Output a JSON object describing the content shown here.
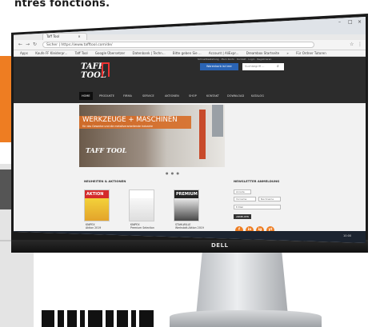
{
  "page": {
    "headline": "ntres fonctions."
  },
  "browser": {
    "tabs": [
      "Taff Tool",
      "×"
    ],
    "url": "Sicher | https://www.tafftool.com/de/",
    "bookmarks": [
      "Apps",
      "Kaufe FF Kleiderpr...",
      "Taff Tool",
      "Google Übersetzer",
      "Datenbank | Techn...",
      "Bitte geben Sie ...",
      "Account | AliExpr...",
      "Dreambox Startseite",
      "»",
      "Für Ordner Tutoren"
    ],
    "nav_icons": [
      "back-icon",
      "forward-icon",
      "reload-icon"
    ]
  },
  "site": {
    "logo": "TAFF TOOL",
    "top_links": [
      "Schnellbestellung",
      "Mein Konto",
      "Kontakt",
      "Login",
      "Registrieren"
    ],
    "header_button": "Warenkorb ist leer",
    "search_placeholder": "Suchbegriff ...",
    "nav": [
      "HOME",
      "PRODUKTE",
      "FIRMA",
      "SERVICE",
      "AKTIONEN",
      "SHOP",
      "KONTAKT",
      "DOWNLOAD",
      "KATALOG"
    ]
  },
  "hero": {
    "title": "WERKZEUGE + MASCHINEN",
    "subtitle": "für das Gewerbe und die metallverarbeitende Industrie",
    "logo": "TAFF TOOL",
    "dots": "● ● ●"
  },
  "promos": {
    "section_title": "NEUHEITEN & AKTIONEN",
    "items": [
      {
        "band": "AKTION",
        "caption_1": "KNIPEX",
        "caption_2": "Aktion 2019"
      },
      {
        "band": "",
        "caption_1": "KNIPEX",
        "caption_2": "Premium Selection"
      },
      {
        "band": "PREMIUM",
        "caption_1": "STAHLWILLE",
        "caption_2": "Werkstatt-Aktion 2019"
      }
    ]
  },
  "newsletter": {
    "title": "NEWSLETTER ANMELDUNG",
    "salutation": "Anrede",
    "firstname": "Vorname",
    "lastname": "Nachname",
    "email": "E-Mail",
    "button": "ANMELDEN"
  },
  "social": [
    "f",
    "in",
    "ig",
    "yt"
  ],
  "taskbar": {
    "clock": "10:00"
  },
  "monitor": {
    "brand": "DELL"
  },
  "colors": {
    "accent_orange": "#ee7d22",
    "header_dark": "#2c2c2c",
    "button_blue": "#2a64b5",
    "promo_red": "#d42b2b"
  }
}
